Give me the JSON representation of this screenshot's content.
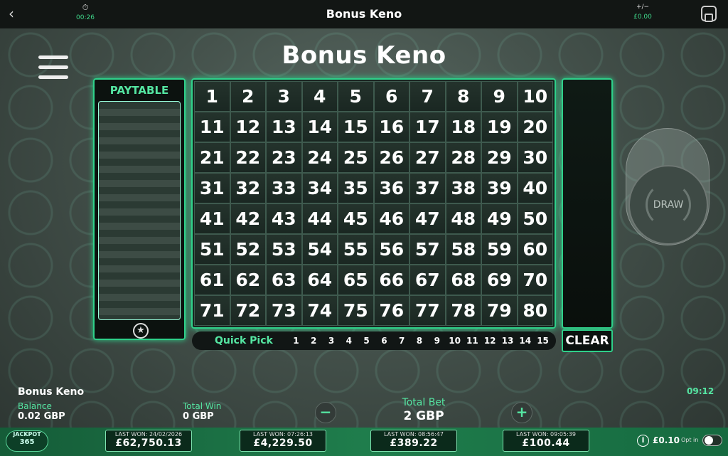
{
  "topbar": {
    "back_icon": "chevron-left-icon",
    "timer": "00:26",
    "title": "Bonus Keno",
    "profit_loss_label": "+/−",
    "profit_loss_value": "£0.00"
  },
  "game": {
    "title": "Bonus Keno",
    "paytable_title": "PAYTABLE",
    "numbers": [
      1,
      2,
      3,
      4,
      5,
      6,
      7,
      8,
      9,
      10,
      11,
      12,
      13,
      14,
      15,
      16,
      17,
      18,
      19,
      20,
      21,
      22,
      23,
      24,
      25,
      26,
      27,
      28,
      29,
      30,
      31,
      32,
      33,
      34,
      35,
      36,
      37,
      38,
      39,
      40,
      41,
      42,
      43,
      44,
      45,
      46,
      47,
      48,
      49,
      50,
      51,
      52,
      53,
      54,
      55,
      56,
      57,
      58,
      59,
      60,
      61,
      62,
      63,
      64,
      65,
      66,
      67,
      68,
      69,
      70,
      71,
      72,
      73,
      74,
      75,
      76,
      77,
      78,
      79,
      80
    ],
    "quick_pick_label": "Quick Pick",
    "quick_pick_options": [
      1,
      2,
      3,
      4,
      5,
      6,
      7,
      8,
      9,
      10,
      11,
      12,
      13,
      14,
      15
    ],
    "clear_label": "CLEAR",
    "draw_label": "DRAW"
  },
  "info": {
    "game_name": "Bonus Keno",
    "balance_label": "Balance",
    "balance_value": "0.02 GBP",
    "total_win_label": "Total Win",
    "total_win_value": "0 GBP",
    "total_bet_label": "Total Bet",
    "total_bet_value": "2 GBP",
    "minus": "−",
    "plus": "+",
    "clock": "09:12"
  },
  "jackpot": {
    "logo_top": "JACKPOT",
    "logo_bottom": "365",
    "tiles": [
      {
        "label": "LAST WON: 24/02/2026",
        "amount": "£62,750.13"
      },
      {
        "label": "LAST WON: 07:26:13",
        "amount": "£4,229.50"
      },
      {
        "label": "LAST WON: 08:56:47",
        "amount": "£389.22"
      },
      {
        "label": "LAST WON: 09:05:39",
        "amount": "£100.44"
      }
    ],
    "stake": "£0.10",
    "opt_in_label": "Opt in",
    "colors": {
      "accent": "#2fd08a",
      "bar": "#1f7d4c"
    }
  }
}
